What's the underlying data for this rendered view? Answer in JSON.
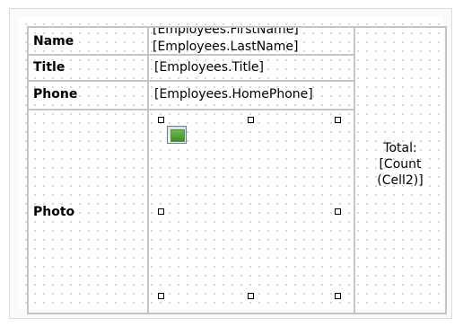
{
  "table": {
    "labels": {
      "name": "Name",
      "title": "Title",
      "phone": "Phone",
      "photo": "Photo"
    },
    "fields": {
      "first_name": "[Employees.FirstName]",
      "last_name": "[Employees.LastName]",
      "title": "[Employees.Title]",
      "phone": "[Employees.HomePhone]"
    },
    "total": {
      "line1": "Total:",
      "line2": "[Count",
      "line3": "(Cell2)]"
    }
  },
  "icons": {
    "photo_placeholder": "picture-icon",
    "resize_handle": "resize-handle"
  },
  "colors": {
    "grid_line": "#c4c4c4",
    "background": "#ffffff"
  }
}
